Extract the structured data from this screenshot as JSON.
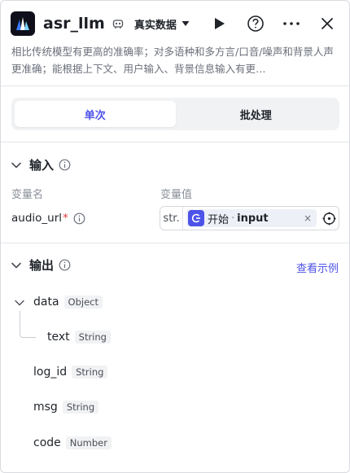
{
  "header": {
    "title": "asr_llm",
    "dataset_label": "真实数据",
    "icons": {
      "logo": "waveform-logo",
      "title_badge": "robot-icon",
      "caret": "caret-down-icon",
      "run": "play-icon",
      "help": "help-icon",
      "more": "more-icon",
      "close": "close-icon"
    }
  },
  "description": "相比传统模型有更高的准确率；对多语种和多方言/口音/噪声和背景人声更准确；能根据上下文、用户输入、背景信息输入有更…",
  "tabs": [
    {
      "label": "单次",
      "active": true
    },
    {
      "label": "批处理",
      "active": false
    }
  ],
  "input_section": {
    "title": "输入",
    "col_name": "变量名",
    "col_value": "变量值",
    "var_name": "audio_url",
    "required_mark": "*",
    "type_label": "str.",
    "ref_source": "开始",
    "ref_sep": "·",
    "ref_var": "input",
    "clear": "×"
  },
  "output_section": {
    "title": "输出",
    "see_example": "查看示例",
    "fields": [
      {
        "name": "data",
        "type": "Object"
      },
      {
        "name": "text",
        "type": "String"
      },
      {
        "name": "log_id",
        "type": "String"
      },
      {
        "name": "msg",
        "type": "String"
      },
      {
        "name": "code",
        "type": "Number"
      }
    ]
  },
  "colors": {
    "accent": "#4d53e8",
    "required": "#e53935"
  }
}
